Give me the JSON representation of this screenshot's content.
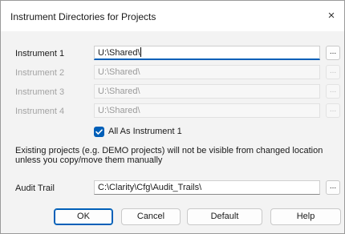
{
  "dialog": {
    "title": "Instrument Directories for Projects",
    "close_glyph": "×"
  },
  "instruments": [
    {
      "label": "Instrument 1",
      "value": "U:\\Shared\\",
      "enabled": true
    },
    {
      "label": "Instrument 2",
      "value": "U:\\Shared\\",
      "enabled": false
    },
    {
      "label": "Instrument 3",
      "value": "U:\\Shared\\",
      "enabled": false
    },
    {
      "label": "Instrument 4",
      "value": "U:\\Shared\\",
      "enabled": false
    }
  ],
  "browse_label": "...",
  "all_as_instrument1": {
    "label": "All As Instrument 1",
    "checked": true
  },
  "note": "Existing projects (e.g. DEMO projects) will not be visible from changed location unless you copy/move them manually",
  "audit_trail": {
    "label": "Audit Trail",
    "value": "C:\\Clarity\\Cfg\\Audit_Trails\\"
  },
  "buttons": {
    "ok": "OK",
    "cancel": "Cancel",
    "default": "Default",
    "help": "Help"
  },
  "colors": {
    "accent": "#005fb8",
    "disabled_text": "#a3a3a3"
  }
}
